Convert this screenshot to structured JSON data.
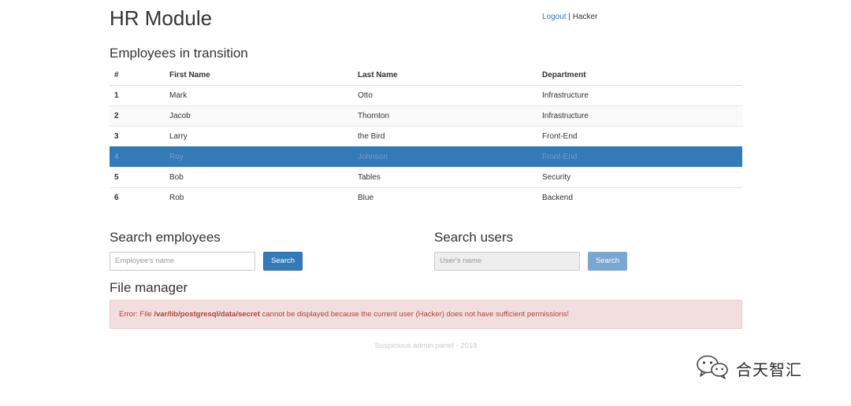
{
  "header": {
    "title": "HR Module",
    "logout_label": "Logout",
    "separator": " | ",
    "username": "Hacker"
  },
  "employees": {
    "title": "Employees in transition",
    "columns": [
      "#",
      "First Name",
      "Last Name",
      "Department"
    ],
    "rows": [
      {
        "num": "1",
        "first": "Mark",
        "last": "Otto",
        "dept": "Infrastructure"
      },
      {
        "num": "2",
        "first": "Jacob",
        "last": "Thornton",
        "dept": "Infrastructure"
      },
      {
        "num": "3",
        "first": "Larry",
        "last": "the Bird",
        "dept": "Front-End"
      },
      {
        "num": "4",
        "first": "Roy",
        "last": "Johnson",
        "dept": "Front-End"
      },
      {
        "num": "5",
        "first": "Bob",
        "last": "Tables",
        "dept": "Security"
      },
      {
        "num": "6",
        "first": "Rob",
        "last": "Blue",
        "dept": "Backend"
      }
    ]
  },
  "search_employees": {
    "title": "Search employees",
    "placeholder": "Employee's name",
    "button_label": "Search"
  },
  "search_users": {
    "title": "Search users",
    "placeholder": "User's name",
    "button_label": "Search"
  },
  "file_manager": {
    "title": "File manager",
    "error_prefix": "Error: File ",
    "error_path": "/var/lib/postgresql/data/secret",
    "error_suffix": " cannot be displayed because the current user (Hacker) does not have sufficient permissions!"
  },
  "footer": {
    "text": "Suspicious admin panel - 2019"
  },
  "watermark": {
    "text": "合天智汇",
    "icon": "wechat-icon"
  },
  "colors": {
    "primary": "#337ab7",
    "selected_row": "#337ab7",
    "alert_bg": "#f2dede",
    "alert_text": "#a94442"
  }
}
